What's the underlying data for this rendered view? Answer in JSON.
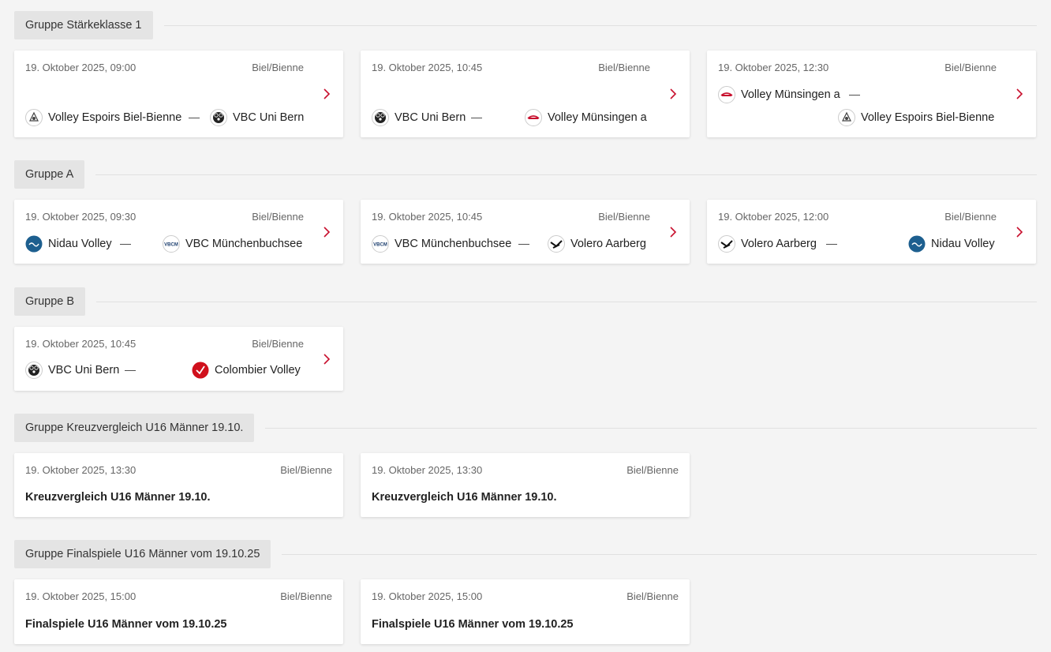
{
  "groups": [
    {
      "label": "Gruppe Stärkeklasse 1",
      "cards": [
        {
          "date": "19. Oktober 2025, 09:00",
          "venue": "Biel/Bienne",
          "home": "Volley Espoirs Biel-Bienne",
          "dash": "—",
          "away": "VBC Uni Bern"
        },
        {
          "date": "19. Oktober 2025, 10:45",
          "venue": "Biel/Bienne",
          "home": "VBC Uni Bern",
          "dash": "—",
          "away": "Volley Münsingen a"
        },
        {
          "date": "19. Oktober 2025, 12:30",
          "venue": "Biel/Bienne",
          "home": "Volley Münsingen a",
          "dash": "—",
          "away": "Volley Espoirs Biel-Bienne"
        }
      ]
    },
    {
      "label": "Gruppe A",
      "cards": [
        {
          "date": "19. Oktober 2025, 09:30",
          "venue": "Biel/Bienne",
          "home": "Nidau Volley",
          "dash": "—",
          "away": "VBC Münchenbuchsee"
        },
        {
          "date": "19. Oktober 2025, 10:45",
          "venue": "Biel/Bienne",
          "home": "VBC Münchenbuchsee",
          "dash": "—",
          "away": "Volero Aarberg"
        },
        {
          "date": "19. Oktober 2025, 12:00",
          "venue": "Biel/Bienne",
          "home": "Volero Aarberg",
          "dash": "—",
          "away": "Nidau Volley"
        }
      ]
    },
    {
      "label": "Gruppe B",
      "cards": [
        {
          "date": "19. Oktober 2025, 10:45",
          "venue": "Biel/Bienne",
          "home": "VBC Uni Bern",
          "dash": "—",
          "away": "Colombier Volley"
        }
      ]
    },
    {
      "label": "Gruppe Kreuzvergleich U16 Männer 19.10.",
      "cards": [
        {
          "date": "19. Oktober 2025, 13:30",
          "venue": "Biel/Bienne",
          "title": "Kreuzvergleich U16 Männer 19.10."
        },
        {
          "date": "19. Oktober 2025, 13:30",
          "venue": "Biel/Bienne",
          "title": "Kreuzvergleich U16 Männer 19.10."
        }
      ]
    },
    {
      "label": "Gruppe Finalspiele U16 Männer vom 19.10.25",
      "cards": [
        {
          "date": "19. Oktober 2025, 15:00",
          "venue": "Biel/Bienne",
          "title": "Finalspiele U16 Männer vom 19.10.25"
        },
        {
          "date": "19. Oktober 2025, 15:00",
          "venue": "Biel/Bienne",
          "title": "Finalspiele U16 Männer vom 19.10.25"
        }
      ]
    }
  ],
  "icons": {
    "chevron": "chevron-right-icon",
    "logos": {
      "Volley Espoirs Biel-Bienne": "espoirs-logo-icon",
      "VBC Uni Bern": "uni-bern-bear-logo-icon",
      "Volley Münsingen a": "muensingen-logo-icon",
      "Nidau Volley": "nidau-logo-icon",
      "VBC Münchenbuchsee": "muenchenbuchsee-logo-icon",
      "Volero Aarberg": "volero-logo-icon",
      "Colombier Volley": "colombier-logo-icon"
    }
  },
  "colors": {
    "accent": "#c8102e",
    "background": "#f4f4f4",
    "card": "#ffffff",
    "group_label_bg": "#e4e4e4"
  }
}
